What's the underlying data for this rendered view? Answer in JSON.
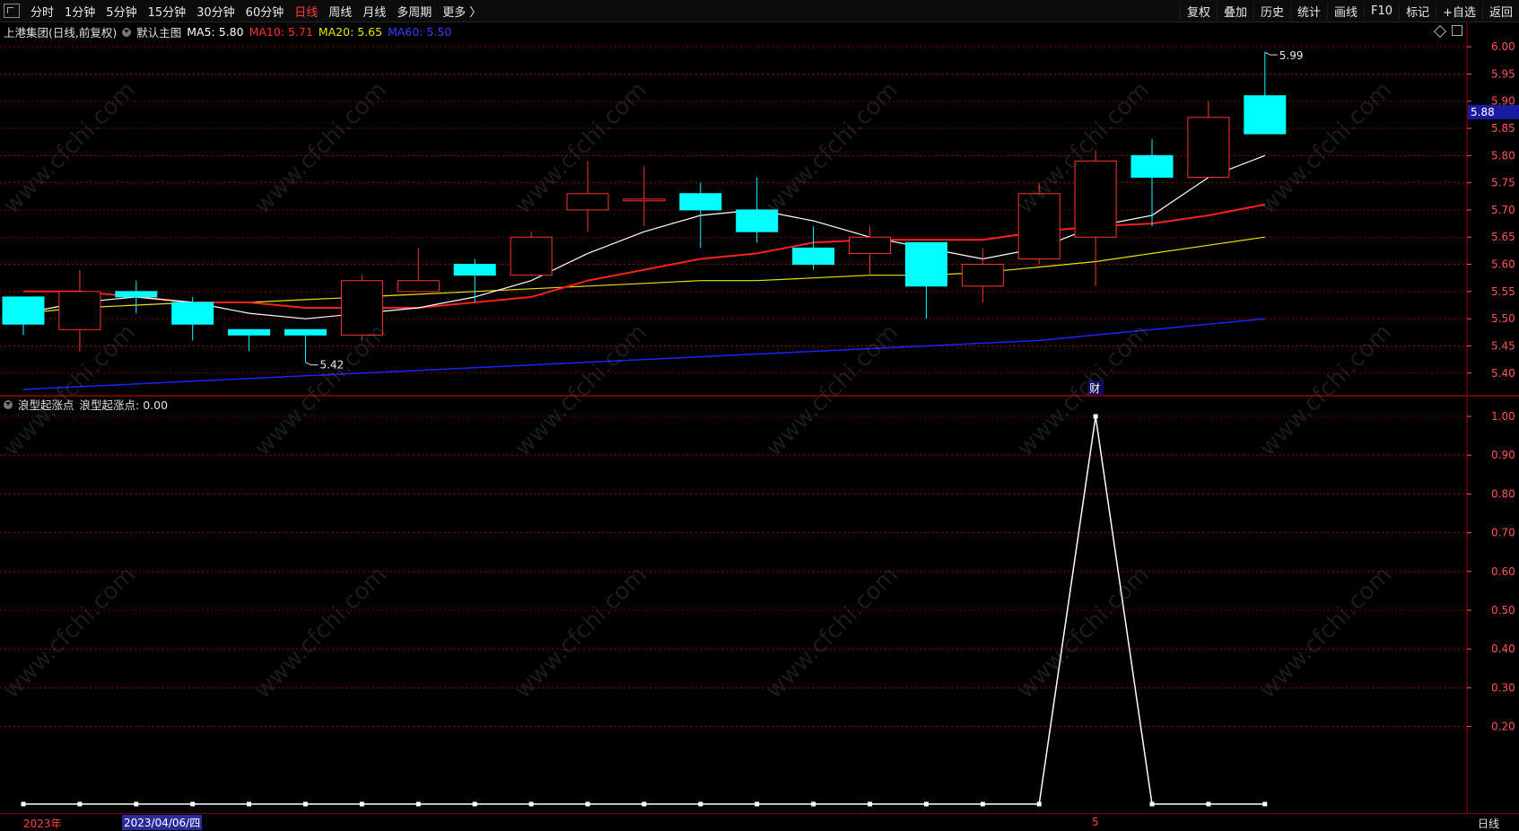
{
  "toolbar": {
    "periods": [
      "分时",
      "1分钟",
      "5分钟",
      "15分钟",
      "30分钟",
      "60分钟",
      "日线",
      "周线",
      "月线",
      "多周期",
      "更多 〉"
    ],
    "active_period": "日线",
    "buttons": [
      "复权",
      "叠加",
      "历史",
      "统计",
      "画线",
      "F10",
      "标记",
      "+自选",
      "返回"
    ]
  },
  "main_info": {
    "stock": "上港集团(日线,前复权)",
    "template": "默认主图",
    "ma5": "MA5: 5.80",
    "ma10": "MA10: 5.71",
    "ma20": "MA20: 5.65",
    "ma60": "MA60: 5.50"
  },
  "sub_info": {
    "indicator": "浪型起涨点",
    "value": "浪型起涨点: 0.00"
  },
  "bottom": {
    "year": "2023年",
    "cursor_date": "2023/04/06/四",
    "month_mark": "5",
    "period_label": "日线"
  },
  "colors": {
    "up": "#ff3232",
    "down": "#00ffff",
    "ma5": "#ffffff",
    "ma10": "#ff2020",
    "ma20": "#e6e600",
    "ma60": "#2020ff",
    "grid": "#7a0000",
    "axis": "#ff5555"
  },
  "chart_data": [
    {
      "type": "candlestick",
      "y_ticks": [
        "6.00",
        "5.95",
        "5.90",
        "5.85",
        "5.80",
        "5.75",
        "5.70",
        "5.65",
        "5.60",
        "5.55",
        "5.50",
        "5.45",
        "5.40"
      ],
      "ylim": [
        5.36,
        6.02
      ],
      "current_price": "5.88",
      "high_label": "5.99",
      "low_label": "5.42",
      "finance_mark": "财",
      "candles": [
        {
          "o": 5.54,
          "h": 5.54,
          "l": 5.47,
          "c": 5.49
        },
        {
          "o": 5.48,
          "h": 5.59,
          "l": 5.44,
          "c": 5.55
        },
        {
          "o": 5.55,
          "h": 5.57,
          "l": 5.51,
          "c": 5.54
        },
        {
          "o": 5.53,
          "h": 5.54,
          "l": 5.46,
          "c": 5.49
        },
        {
          "o": 5.48,
          "h": 5.48,
          "l": 5.44,
          "c": 5.47
        },
        {
          "o": 5.48,
          "h": 5.48,
          "l": 5.42,
          "c": 5.47
        },
        {
          "o": 5.47,
          "h": 5.58,
          "l": 5.46,
          "c": 5.57
        },
        {
          "o": 5.55,
          "h": 5.63,
          "l": 5.55,
          "c": 5.57
        },
        {
          "o": 5.6,
          "h": 5.61,
          "l": 5.53,
          "c": 5.58
        },
        {
          "o": 5.58,
          "h": 5.66,
          "l": 5.58,
          "c": 5.65
        },
        {
          "o": 5.7,
          "h": 5.79,
          "l": 5.66,
          "c": 5.73
        },
        {
          "o": 5.72,
          "h": 5.78,
          "l": 5.67,
          "c": 5.72
        },
        {
          "o": 5.73,
          "h": 5.75,
          "l": 5.63,
          "c": 5.7
        },
        {
          "o": 5.7,
          "h": 5.76,
          "l": 5.64,
          "c": 5.66
        },
        {
          "o": 5.63,
          "h": 5.67,
          "l": 5.59,
          "c": 5.6
        },
        {
          "o": 5.62,
          "h": 5.67,
          "l": 5.58,
          "c": 5.65
        },
        {
          "o": 5.64,
          "h": 5.64,
          "l": 5.5,
          "c": 5.56
        },
        {
          "o": 5.56,
          "h": 5.63,
          "l": 5.53,
          "c": 5.6
        },
        {
          "o": 5.61,
          "h": 5.75,
          "l": 5.6,
          "c": 5.73
        },
        {
          "o": 5.65,
          "h": 5.81,
          "l": 5.56,
          "c": 5.79
        },
        {
          "o": 5.8,
          "h": 5.83,
          "l": 5.67,
          "c": 5.76
        },
        {
          "o": 5.76,
          "h": 5.9,
          "l": 5.76,
          "c": 5.87
        },
        {
          "o": 5.91,
          "h": 5.99,
          "l": 5.84,
          "c": 5.84
        }
      ],
      "ma5": [
        5.51,
        5.53,
        5.54,
        5.53,
        5.51,
        5.5,
        5.51,
        5.52,
        5.54,
        5.57,
        5.62,
        5.66,
        5.69,
        5.7,
        5.68,
        5.65,
        5.63,
        5.61,
        5.63,
        5.67,
        5.69,
        5.76,
        5.8
      ],
      "ma10": [
        5.55,
        5.55,
        5.54,
        5.53,
        5.53,
        5.52,
        5.52,
        5.52,
        5.53,
        5.54,
        5.57,
        5.59,
        5.61,
        5.62,
        5.64,
        5.645,
        5.645,
        5.645,
        5.66,
        5.67,
        5.675,
        5.69,
        5.71
      ],
      "ma20": [
        5.51,
        5.52,
        5.525,
        5.53,
        5.53,
        5.535,
        5.54,
        5.545,
        5.55,
        5.555,
        5.56,
        5.565,
        5.57,
        5.57,
        5.575,
        5.58,
        5.58,
        5.585,
        5.595,
        5.605,
        5.62,
        5.635,
        5.65
      ],
      "ma60": [
        5.37,
        5.375,
        5.38,
        5.385,
        5.39,
        5.395,
        5.4,
        5.405,
        5.41,
        5.415,
        5.42,
        5.425,
        5.43,
        5.435,
        5.44,
        5.445,
        5.45,
        5.455,
        5.46,
        5.47,
        5.48,
        5.49,
        5.5
      ]
    },
    {
      "type": "line",
      "name": "浪型起涨点",
      "y_ticks": [
        "1.00",
        "0.90",
        "0.80",
        "0.70",
        "0.60",
        "0.50",
        "0.40",
        "0.30",
        "0.20"
      ],
      "ylim": [
        0.0,
        1.0
      ],
      "values": [
        0,
        0,
        0,
        0,
        0,
        0,
        0,
        0,
        0,
        0,
        0,
        0,
        0,
        0,
        0,
        0,
        0,
        0,
        0,
        1,
        0,
        0,
        0
      ]
    }
  ]
}
